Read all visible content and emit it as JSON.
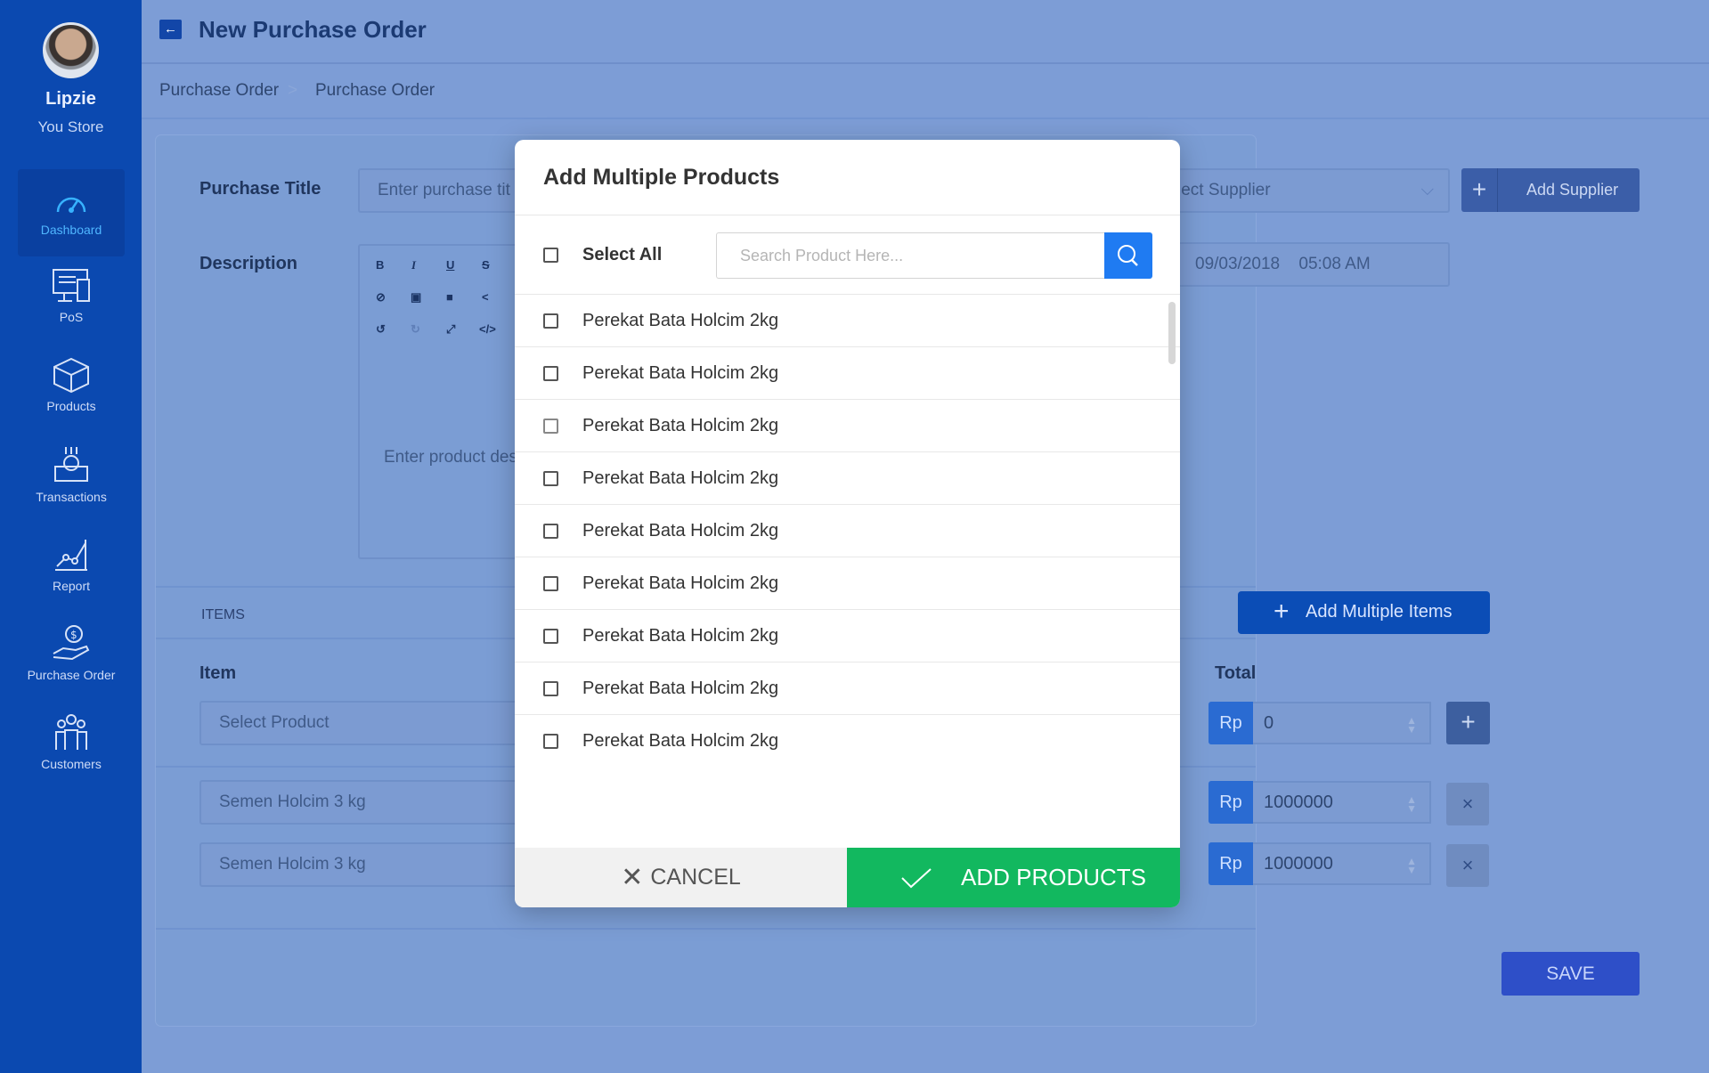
{
  "user": {
    "name": "Lipzie",
    "store": "You Store"
  },
  "nav": [
    "Dashboard",
    "PoS",
    "Products",
    "Transactions",
    "Report",
    "Purchase Order",
    "Customers"
  ],
  "header": {
    "title": "New Purchase Order"
  },
  "breadcrumb": [
    "Purchase Order",
    "Purchase Order"
  ],
  "form": {
    "title_label": "Purchase Title",
    "title_placeholder": "Enter purchase tit",
    "supplier_placeholder": "lect Supplier",
    "add_supplier": "Add Supplier",
    "description_label": "Description",
    "description_placeholder": "Enter product des",
    "date": "09/03/2018",
    "time": "05:08 AM",
    "items_header": "ITEMS",
    "add_multiple_items": "Add Multiple Items",
    "item_col": "Item",
    "total_col": "Total",
    "select_product": "Select Product",
    "currency": "Rp",
    "rows": [
      {
        "item": "",
        "total": "0"
      },
      {
        "item": "Semen Holcim 3 kg",
        "total": "1000000"
      },
      {
        "item": "Semen Holcim 3 kg",
        "total": "1000000"
      }
    ],
    "save": "SAVE"
  },
  "modal": {
    "title": "Add Multiple Products",
    "select_all": "Select All",
    "search_placeholder": "Search Product Here...",
    "products": [
      "Perekat Bata Holcim 2kg",
      "Perekat Bata Holcim 2kg",
      "Perekat Bata Holcim 2kg",
      "Perekat Bata Holcim 2kg",
      "Perekat Bata Holcim 2kg",
      "Perekat Bata Holcim 2kg",
      "Perekat Bata Holcim 2kg",
      "Perekat Bata Holcim 2kg",
      "Perekat Bata Holcim 2kg"
    ],
    "cancel": "CANCEL",
    "add_products": "ADD PRODUCTS"
  },
  "colors": {
    "sidebar": "#0b49b0",
    "accent": "#1f7bf2",
    "success": "#12b85f",
    "overlay": "#7d9dd6"
  }
}
